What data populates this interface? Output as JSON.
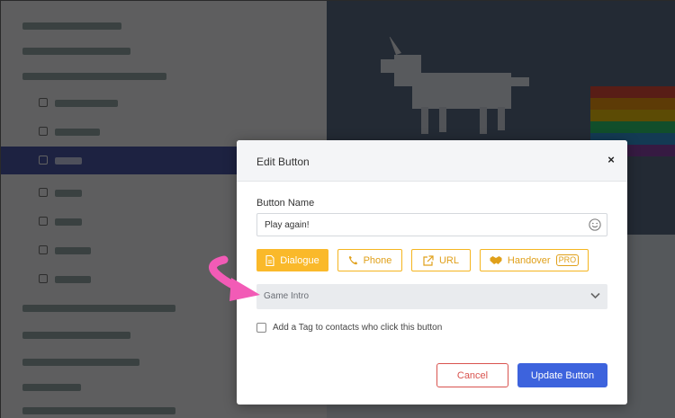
{
  "modal": {
    "title": "Edit Button",
    "close_label": "×",
    "button_name_label": "Button Name",
    "button_name_value": "Play again!",
    "type_buttons": [
      {
        "label": "Dialogue",
        "icon": "document-icon",
        "selected": true
      },
      {
        "label": "Phone",
        "icon": "phone-icon",
        "selected": false
      },
      {
        "label": "URL",
        "icon": "external-link-icon",
        "selected": false
      },
      {
        "label": "Handover",
        "icon": "handshake-icon",
        "selected": false,
        "badge": "PRO"
      }
    ],
    "dialogue_select_value": "Game Intro",
    "tag_checkbox_label": "Add a Tag to contacts who click this button",
    "tag_checked": false,
    "cancel_label": "Cancel",
    "update_label": "Update Button"
  },
  "colors": {
    "accent": "#fab92a",
    "primary": "#3d63dd",
    "danger": "#d9534f",
    "annotation_arrow": "#f25bb6"
  }
}
